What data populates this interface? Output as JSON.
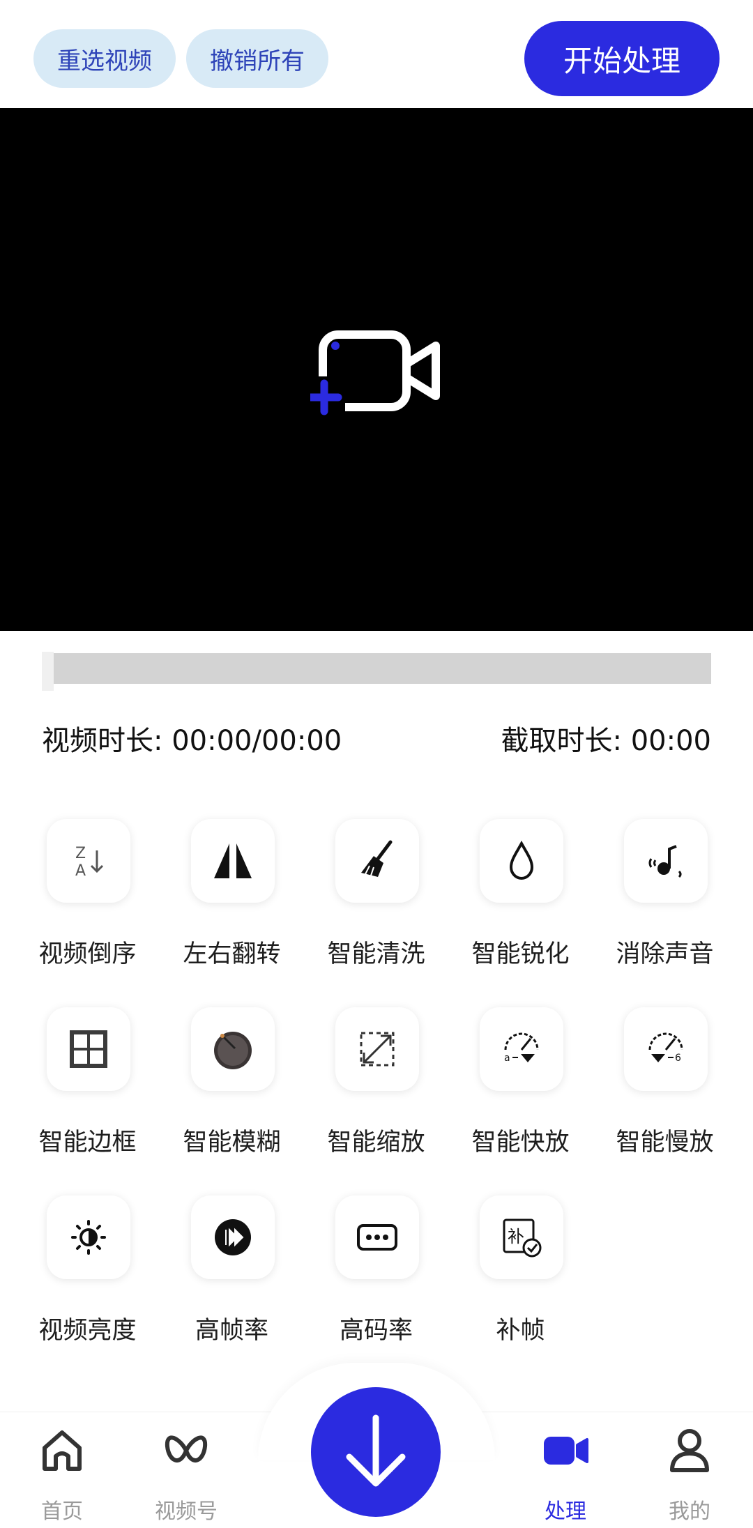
{
  "header": {
    "reselect_label": "重选视频",
    "undo_label": "撤销所有",
    "start_label": "开始处理"
  },
  "video": {
    "placeholder_icon": "add-video-icon"
  },
  "progress": {
    "value": 0
  },
  "durations": {
    "video_label": "视频时长: 00:00/00:00",
    "clip_label": "截取时长: 00:00"
  },
  "tools": [
    {
      "label": "视频倒序",
      "icon": "sort-za-icon"
    },
    {
      "label": "左右翻转",
      "icon": "flip-horizontal-icon"
    },
    {
      "label": "智能清洗",
      "icon": "broom-icon"
    },
    {
      "label": "智能锐化",
      "icon": "droplet-icon"
    },
    {
      "label": "消除声音",
      "icon": "mute-note-icon"
    },
    {
      "label": "智能边框",
      "icon": "frame-icon"
    },
    {
      "label": "智能模糊",
      "icon": "blur-icon"
    },
    {
      "label": "智能缩放",
      "icon": "resize-icon"
    },
    {
      "label": "智能快放",
      "icon": "fast-gauge-icon"
    },
    {
      "label": "智能慢放",
      "icon": "slow-gauge-icon"
    },
    {
      "label": "视频亮度",
      "icon": "brightness-icon"
    },
    {
      "label": "高帧率",
      "icon": "fast-forward-icon"
    },
    {
      "label": "高码率",
      "icon": "bitrate-icon"
    },
    {
      "label": "补帧",
      "icon": "frame-fill-icon"
    }
  ],
  "nav": {
    "items": [
      {
        "label": "首页",
        "icon": "home-icon"
      },
      {
        "label": "视频号",
        "icon": "channels-icon"
      },
      {
        "label": "处理",
        "icon": "video-camera-icon",
        "active": true
      },
      {
        "label": "我的",
        "icon": "profile-icon"
      }
    ],
    "fab_icon": "download-arrow-icon"
  },
  "colors": {
    "accent": "#2b2be0",
    "pill_bg": "#d8eaf6",
    "pill_text": "#2d43b8",
    "nav_inactive": "#9a9a9a"
  }
}
